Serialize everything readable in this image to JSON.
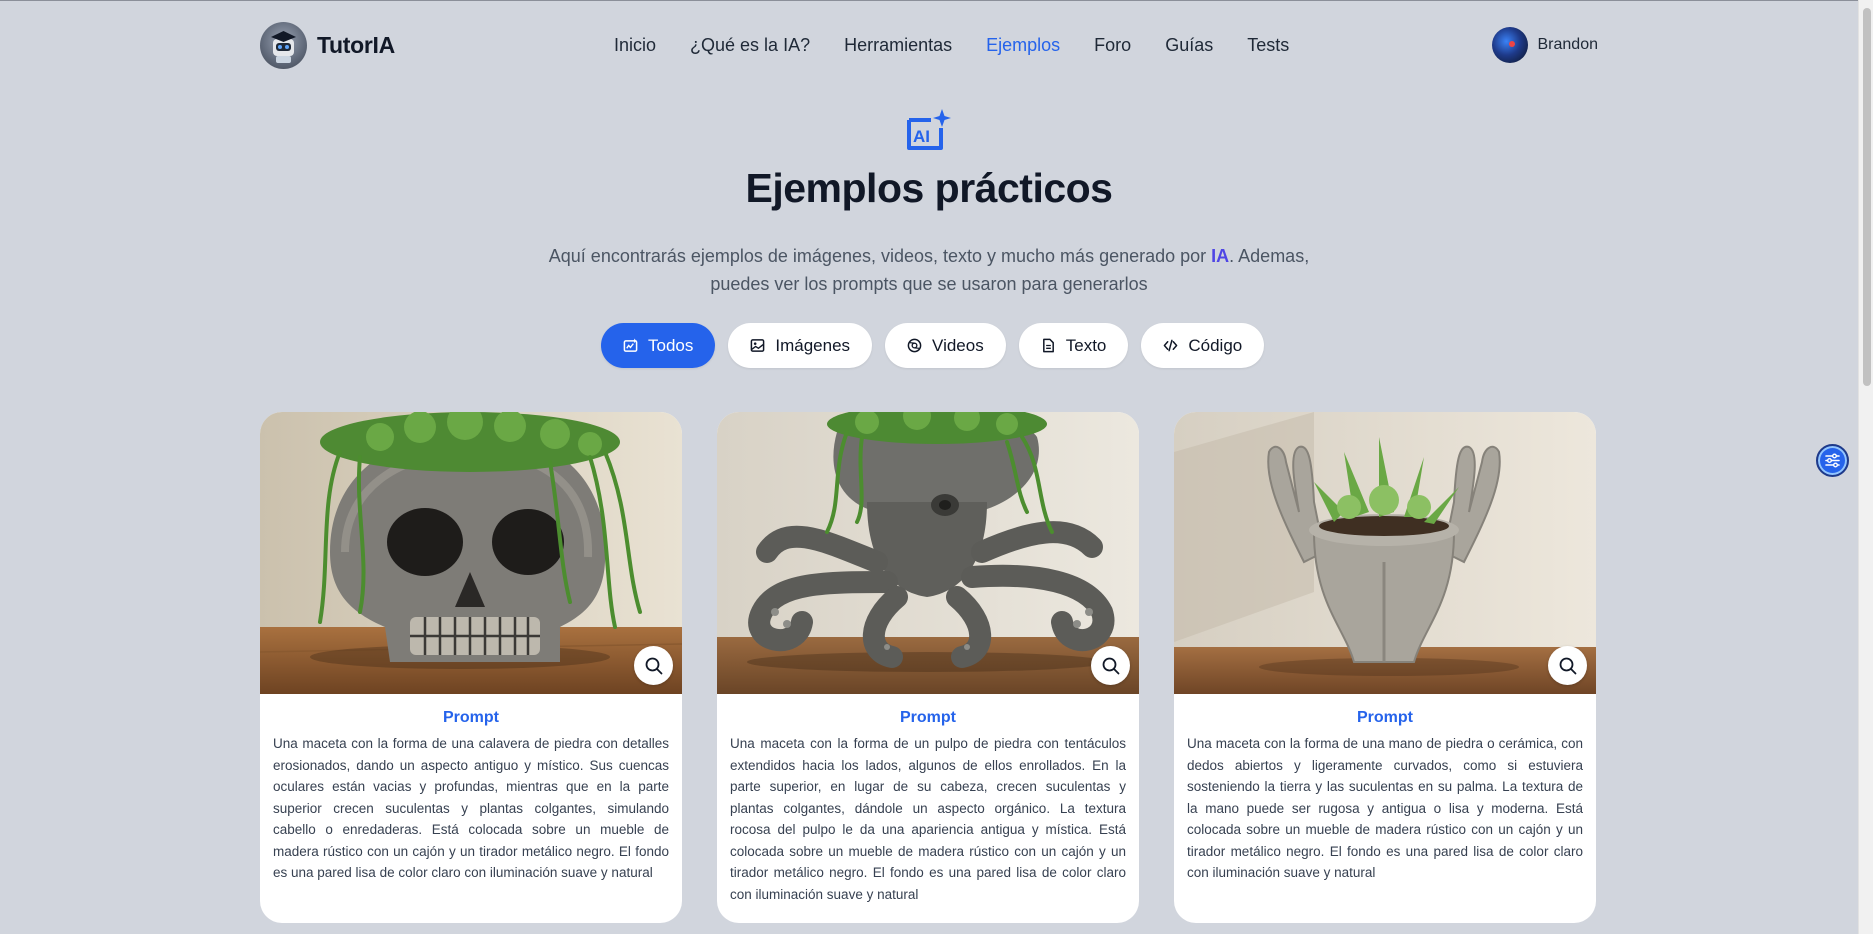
{
  "nav": {
    "brand": "TutorIA",
    "links": [
      {
        "label": "Inicio"
      },
      {
        "label": "¿Qué es la IA?"
      },
      {
        "label": "Herramientas"
      },
      {
        "label": "Ejemplos",
        "active": true
      },
      {
        "label": "Foro"
      },
      {
        "label": "Guías"
      },
      {
        "label": "Tests"
      }
    ],
    "user": "Brandon"
  },
  "hero": {
    "icon": "ai-sparkle-icon",
    "title": "Ejemplos prácticos",
    "subtitle_before": "Aquí encontrarás ejemplos de imágenes, videos, texto y mucho más generado por ",
    "subtitle_highlight": "IA",
    "subtitle_after": ". Ademas, puedes ver los prompts que se usaron para generarlos"
  },
  "filters": [
    {
      "label": "Todos",
      "icon": "all-icon",
      "active": true
    },
    {
      "label": "Imágenes",
      "icon": "image-icon"
    },
    {
      "label": "Videos",
      "icon": "video-icon"
    },
    {
      "label": "Texto",
      "icon": "document-icon"
    },
    {
      "label": "Código",
      "icon": "code-icon"
    }
  ],
  "cards": [
    {
      "label": "Prompt",
      "text": "Una maceta con la forma de una calavera de piedra con detalles erosionados, dando un aspecto antiguo y místico. Sus cuencas oculares están vacias y profundas, mientras que en la parte superior crecen suculentas y plantas colgantes, simulando cabello o enredaderas. Está colocada sobre un mueble de madera rústico con un cajón y un tirador metálico negro. El fondo es una pared lisa de color claro con iluminación suave y natural"
    },
    {
      "label": "Prompt",
      "text": "Una maceta con la forma de un pulpo de piedra con tentáculos extendidos hacia los lados, algunos de ellos enrollados. En la parte superior, en lugar de su cabeza, crecen suculentas y plantas colgantes, dándole un aspecto orgánico. La textura rocosa del pulpo le da una apariencia antigua y mística. Está colocada sobre un mueble de madera rústico con un cajón y un tirador metálico negro. El fondo es una pared lisa de color claro con iluminación suave y natural"
    },
    {
      "label": "Prompt",
      "text": "Una maceta con la forma de una mano de piedra o cerámica, con dedos abiertos y ligeramente curvados, como si estuviera sosteniendo la tierra y las suculentas en su palma. La textura de la mano puede ser rugosa y antigua o lisa y moderna. Está colocada sobre un mueble de madera rústico con un cajón y un tirador metálico negro. El fondo es una pared lisa de color claro con iluminación suave y natural"
    }
  ],
  "colors": {
    "accent": "#2563eb",
    "background": "#d1d5dd",
    "highlight": "#4f46e5"
  }
}
